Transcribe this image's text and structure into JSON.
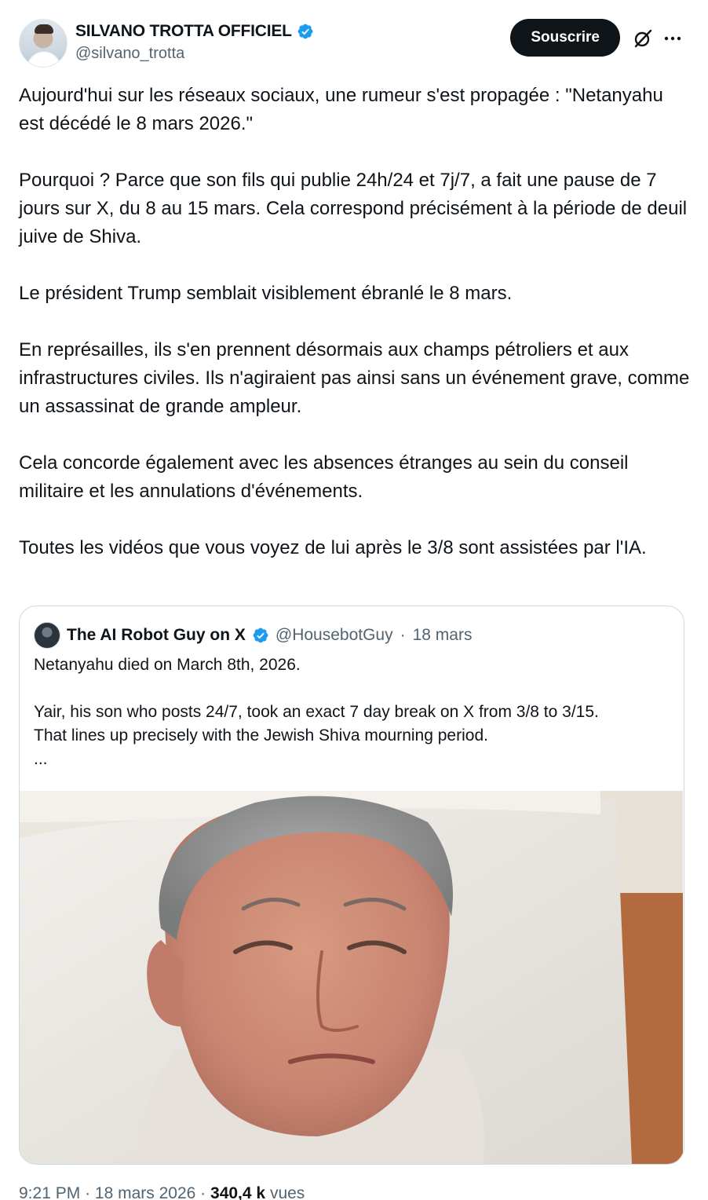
{
  "author": {
    "display_name": "SILVANO TROTTA OFFICIEL",
    "handle": "@silvano_trotta",
    "verified": true
  },
  "actions": {
    "subscribe_label": "Souscrire",
    "grok_icon": "grok-icon",
    "more_icon": "more-icon"
  },
  "post": {
    "paragraphs": [
      "Aujourd'hui sur les réseaux sociaux, une rumeur s'est propagée : \"Netanyahu est décédé le 8 mars 2026.\"",
      "Pourquoi ? Parce que son fils qui publie 24h/24 et 7j/7, a fait une pause de 7 jours sur X, du 8 au 15 mars. Cela correspond précisément à la période de deuil juive de Shiva.",
      "Le président Trump semblait visiblement ébranlé le 8 mars.",
      "En représailles, ils s'en prennent désormais aux champs pétroliers et aux infrastructures civiles. Ils n'agiraient pas ainsi sans un événement grave, comme un assassinat de grande ampleur.",
      "Cela concorde également avec les absences étranges au sein du conseil militaire et les annulations d'événements.",
      "Toutes les vidéos que vous voyez de lui après le 3/8 sont assistées par l'IA."
    ]
  },
  "quote": {
    "display_name": "The AI Robot Guy on X",
    "handle": "@HousebotGuy",
    "separator": "·",
    "date": "18 mars",
    "line1": "Netanyahu died on March 8th, 2026.",
    "line2": "Yair, his son who posts 24/7, took an exact 7 day break on X from 3/8 to 3/15.",
    "line3": "That lines up precisely with the Jewish Shiva mourning period.",
    "ellipsis": "..."
  },
  "meta": {
    "time": "9:21 PM",
    "separator": "·",
    "date": "18 mars 2026",
    "views_count": "340,4 k",
    "views_label": "vues"
  },
  "colors": {
    "text": "#0f1419",
    "secondary": "#536471",
    "border": "#cfd9de",
    "verified": "#1d9bf0",
    "button": "#0f1419"
  }
}
